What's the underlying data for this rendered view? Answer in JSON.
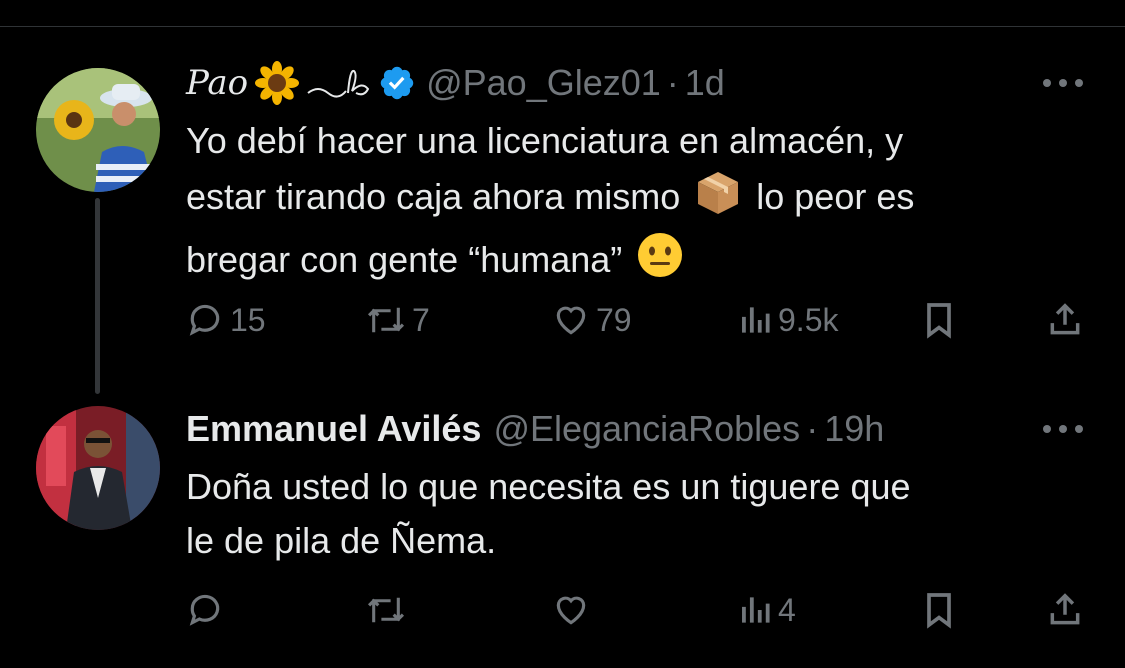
{
  "colors": {
    "background": "#000000",
    "text": "#e7e9ea",
    "muted": "#71767b",
    "verified": "#1d9bf0",
    "divider": "#2f3336"
  },
  "tweets": [
    {
      "display_name": "Pao",
      "verified": true,
      "handle": "@Pao_Glez01",
      "separator": "·",
      "time": "1d",
      "text_lines": [
        "Yo debí hacer una licenciatura en almacén, y",
        "estar tirando caja ahora mismo",
        "lo peor es",
        "bregar con gente “humana”"
      ],
      "emojis": [
        "sunflower-icon",
        "package-icon",
        "neutral-face-icon"
      ],
      "stats": {
        "replies": "15",
        "reposts": "7",
        "likes": "79",
        "views": "9.5k"
      }
    },
    {
      "display_name": "Emmanuel Avilés",
      "verified": false,
      "handle": "@EleganciaRobles",
      "separator": "·",
      "time": "19h",
      "text_lines": [
        "Doña usted lo que necesita es un tiguere que",
        "le de pila de Ñema."
      ],
      "stats": {
        "replies": "",
        "reposts": "",
        "likes": "",
        "views": "4"
      }
    }
  ]
}
